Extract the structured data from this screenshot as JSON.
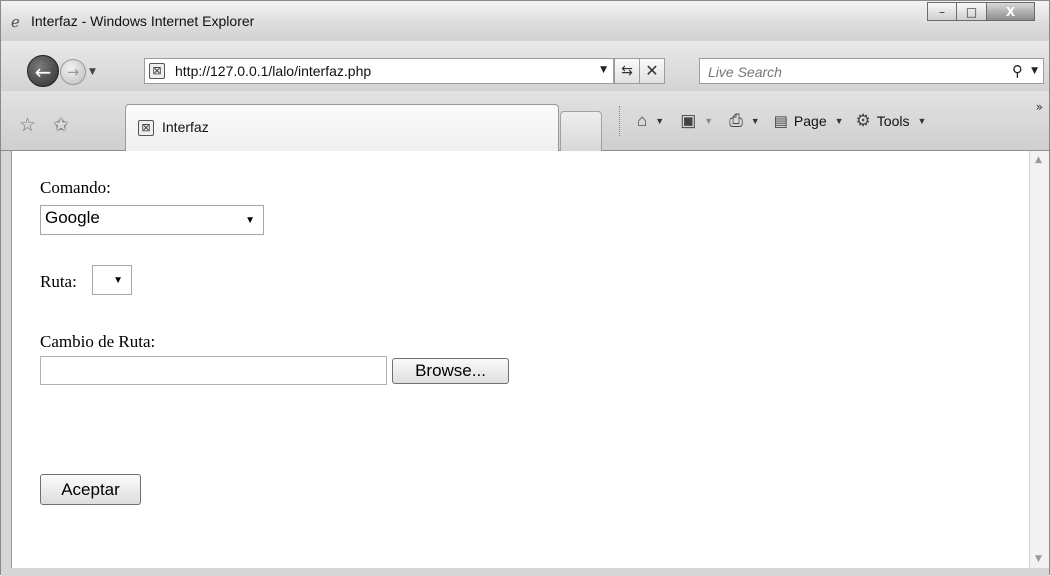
{
  "window": {
    "title": "Interfaz - Windows Internet Explorer",
    "controls": {
      "minimize": "–",
      "maximize": "□",
      "close": "X"
    }
  },
  "navigation": {
    "address": "http://127.0.0.1/lalo/interfaz.php",
    "search_placeholder": "Live Search"
  },
  "tabs": [
    {
      "label": "Interfaz"
    }
  ],
  "command_bar": {
    "page_label": "Page",
    "tools_label": "Tools"
  },
  "form": {
    "comando_label": "Comando:",
    "comando_value": "Google",
    "ruta_label": "Ruta:",
    "ruta_value": "",
    "cambio_ruta_label": "Cambio de Ruta:",
    "browse_label": "Browse...",
    "submit_label": "Aceptar"
  },
  "icons": {
    "browser": "ie-icon",
    "back": "back-arrow-icon",
    "forward": "forward-arrow-icon",
    "refresh": "refresh-icon",
    "stop": "stop-icon",
    "search": "search-icon",
    "favorites": "favorites-star-icon",
    "add_favorites": "add-favorites-icon",
    "home": "home-icon",
    "feeds": "rss-icon",
    "print": "printer-icon",
    "page": "page-icon",
    "tools": "gear-icon"
  }
}
